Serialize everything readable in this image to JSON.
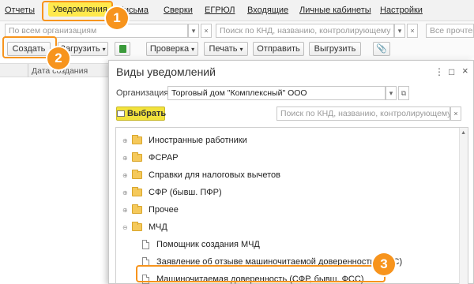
{
  "menu": {
    "items": [
      "Отчеты",
      "Уведомления",
      "Письма",
      "Сверки",
      "ЕГРЮЛ",
      "Входящие",
      "Личные кабинеты",
      "Настройки"
    ]
  },
  "filters": {
    "org_placeholder": "По всем организациям",
    "search_placeholder": "Поиск по КНД, названию, контролирующему о...",
    "status_placeholder": "Все прочтен"
  },
  "toolbar": {
    "create": "Создать",
    "load": "Загрузить",
    "check": "Проверка",
    "print": "Печать",
    "send": "Отправить",
    "export": "Выгрузить"
  },
  "list": {
    "col_date": "Дата создания"
  },
  "dialog": {
    "title": "Виды уведомлений",
    "org_label": "Организация:",
    "org_value": "Торговый дом \"Комплексный\" ООО",
    "select_button": "Выбрать",
    "search_placeholder": "Поиск по КНД, названию, контролирующему...",
    "tree": [
      {
        "label": "Иностранные работники",
        "type": "folder",
        "expanded": false
      },
      {
        "label": "ФСРАР",
        "type": "folder",
        "expanded": false
      },
      {
        "label": "Справки для налоговых вычетов",
        "type": "folder",
        "expanded": false
      },
      {
        "label": "СФР (бывш. ПФР)",
        "type": "folder",
        "expanded": false
      },
      {
        "label": "Прочее",
        "type": "folder",
        "expanded": false
      },
      {
        "label": "МЧД",
        "type": "folder",
        "expanded": true
      },
      {
        "label": "Помощник создания МЧД",
        "type": "document"
      },
      {
        "label": "Заявление об отзыве машиночитаемой доверенности (ФНС)",
        "type": "document"
      },
      {
        "label": "Машиночитаемая доверенность (СФР, бывш. ФСС)",
        "type": "document",
        "selected": true
      }
    ]
  },
  "callouts": {
    "step1": "1",
    "step2": "2",
    "step3": "3",
    "color": "#f7941d"
  },
  "colors": {
    "active_tab": "#ffe94d",
    "select_button": "#f2e23c",
    "folder": "#f5c95b"
  }
}
